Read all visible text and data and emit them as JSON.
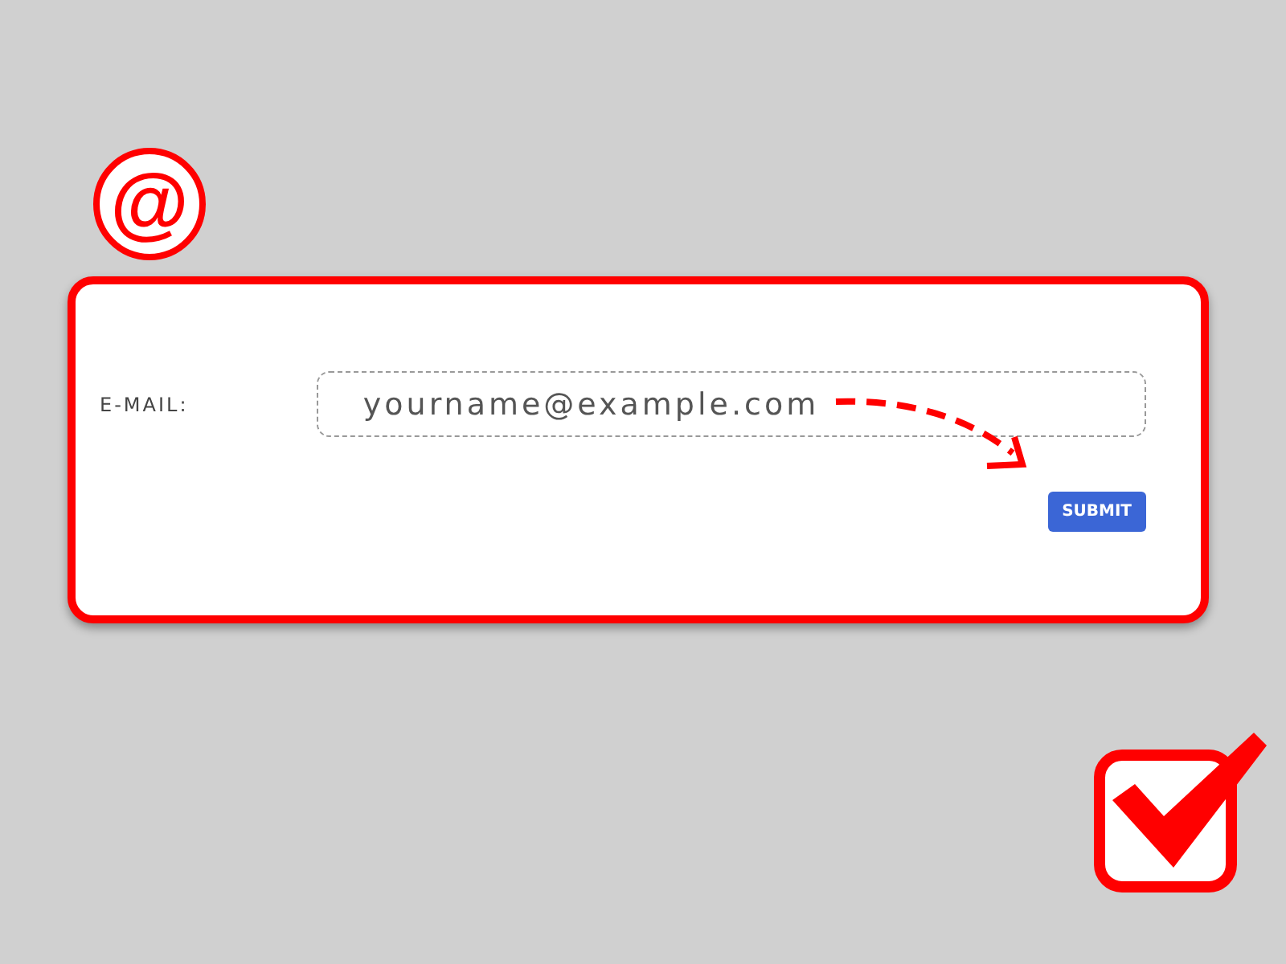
{
  "badge": "@",
  "form": {
    "label": "E-MAIL:",
    "field": {
      "placeholder": "yourname@example.com"
    },
    "button": "SUBMIT"
  },
  "checkbox": {
    "checked": true
  }
}
